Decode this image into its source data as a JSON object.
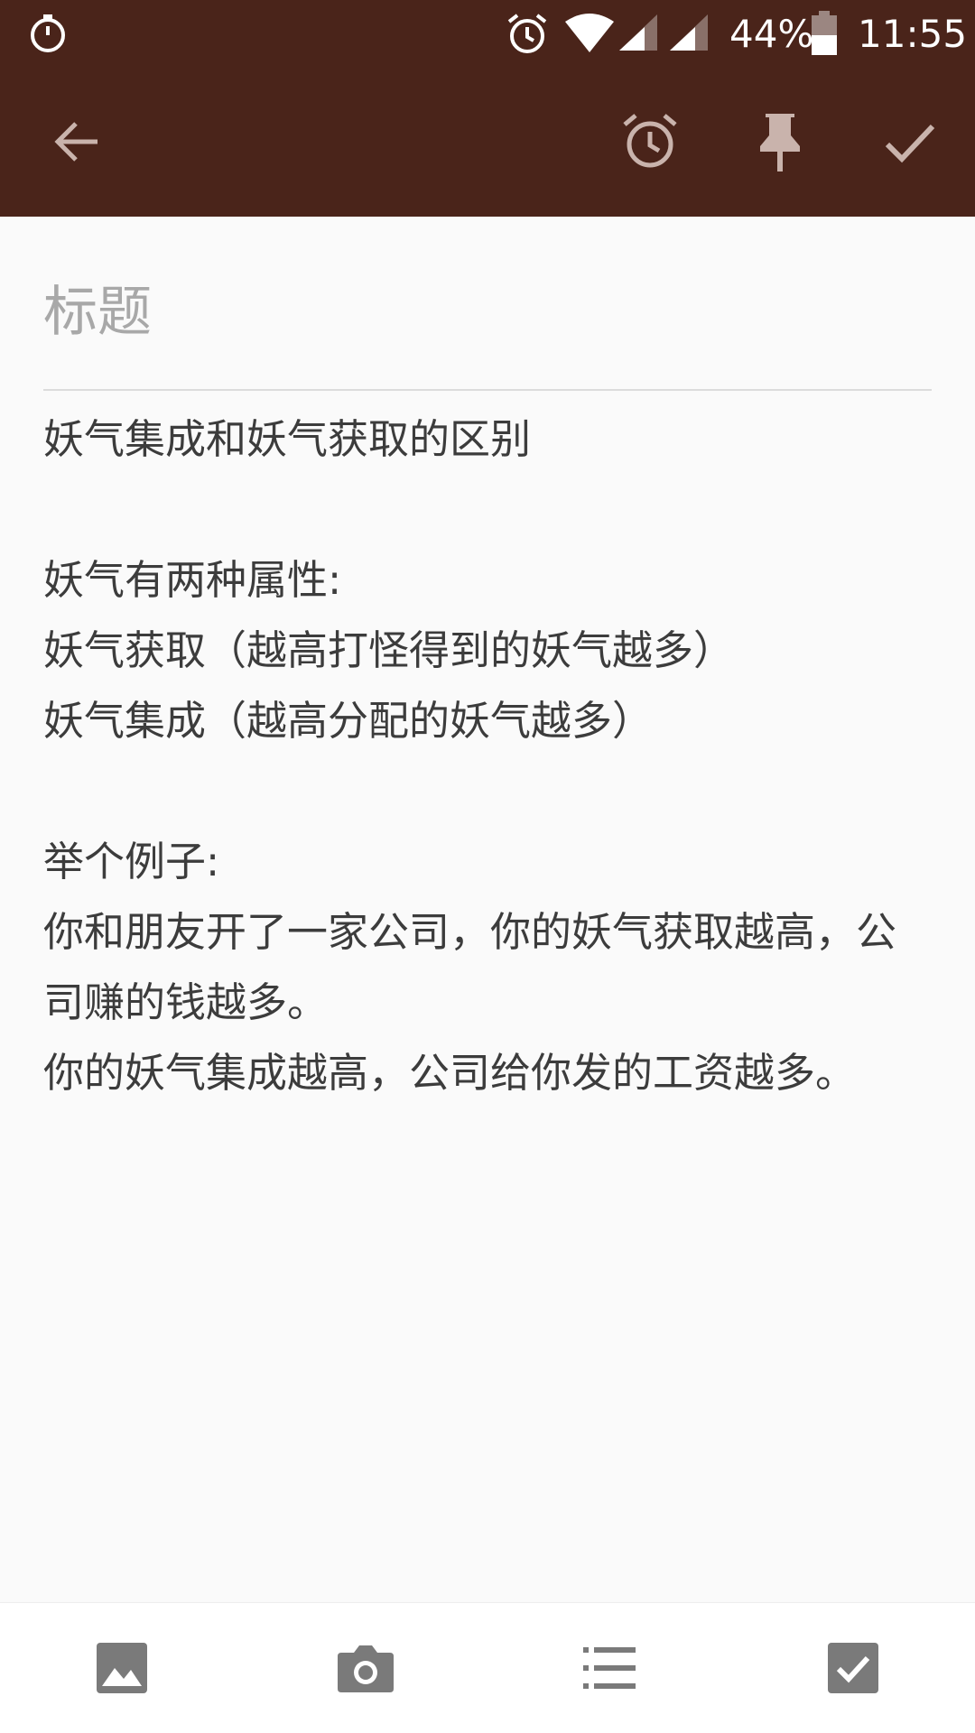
{
  "status_bar": {
    "battery_percent": "44%",
    "time": "11:55",
    "icons": [
      "stopwatch-icon",
      "alarm-icon",
      "wifi-icon",
      "signal-icon",
      "signal-icon",
      "battery-icon"
    ]
  },
  "toolbar": {
    "icons": [
      "back-arrow-icon",
      "reminder-alarm-icon",
      "pin-icon",
      "check-icon"
    ],
    "color": "#4a241a"
  },
  "note": {
    "title_placeholder": "标题",
    "lines": [
      "妖气集成和妖气获取的区别",
      "",
      "妖气有两种属性:",
      "妖气获取（越高打怪得到的妖气越多）",
      "妖气集成（越高分配的妖气越多）",
      "",
      "举个例子:",
      "你和朋友开了一家公司，你的妖气获取越高，公",
      "司赚的钱越多。",
      "你的妖气集成越高，公司给你发的工资越多。"
    ]
  },
  "bottom_bar": {
    "icons": [
      "image-icon",
      "camera-icon",
      "list-icon",
      "checkbox-icon"
    ]
  }
}
